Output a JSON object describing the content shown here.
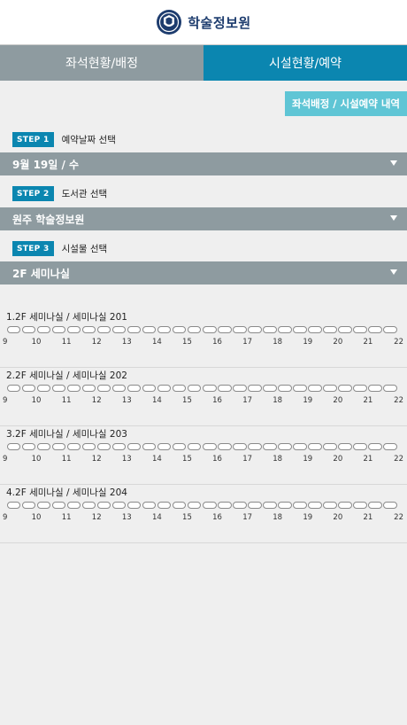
{
  "header": {
    "logo_text": "학술정보원",
    "logo_icon": "university-seal-icon"
  },
  "tabs": [
    {
      "label": "좌석현황/배정",
      "active": false
    },
    {
      "label": "시설현황/예약",
      "active": true
    }
  ],
  "history_button": {
    "label": "좌석배정 / 시설예약 내역"
  },
  "steps": [
    {
      "badge": "STEP 1",
      "label": "예약날짜 선택",
      "value": "9월 19일 / 수"
    },
    {
      "badge": "STEP 2",
      "label": "도서관 선택",
      "value": "원주 학술정보원"
    },
    {
      "badge": "STEP 3",
      "label": "시설물 선택",
      "value": "2F 세미나실"
    }
  ],
  "hours": [
    "9",
    "10",
    "11",
    "12",
    "13",
    "14",
    "15",
    "16",
    "17",
    "18",
    "19",
    "20",
    "21",
    "22"
  ],
  "rooms": [
    {
      "title": "1.2F 세미나실 / 세미나실 201"
    },
    {
      "title": "2.2F 세미나실 / 세미나실 202"
    },
    {
      "title": "3.2F 세미나실 / 세미나실 203"
    },
    {
      "title": "4.2F 세미나실 / 세미나실 204"
    }
  ],
  "colors": {
    "accent": "#0b86b0",
    "gray_bar": "#8e9ba0",
    "history_btn": "#5fc5d5",
    "background": "#efefef"
  }
}
